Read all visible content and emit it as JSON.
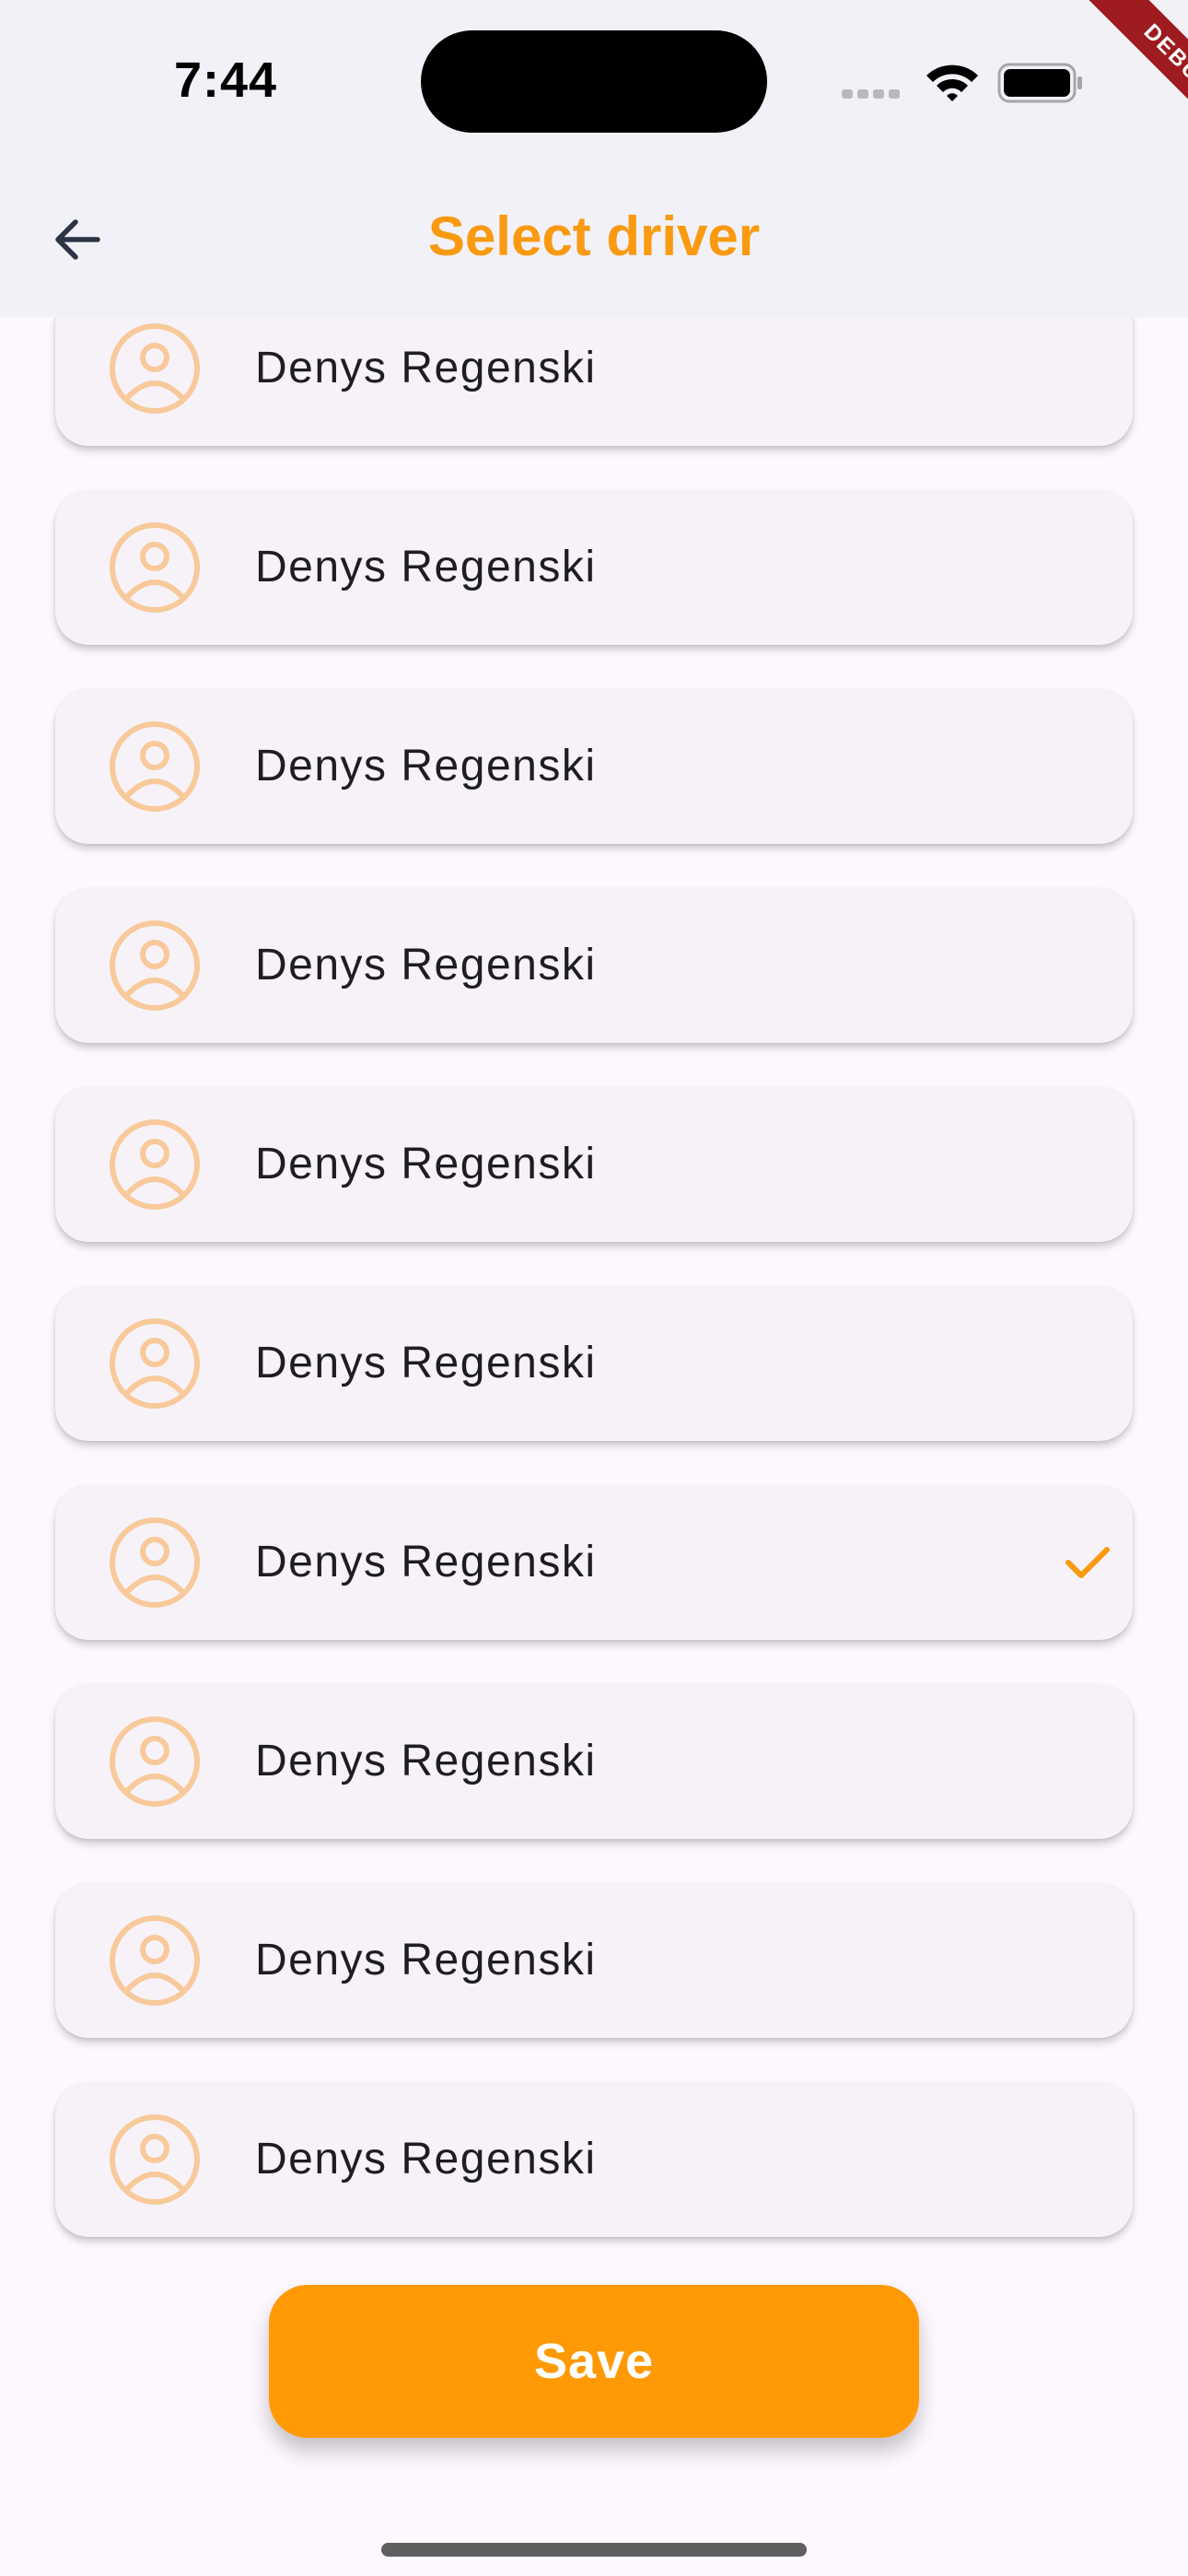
{
  "status_bar": {
    "time": "7:44",
    "debug_label": "DEBUG"
  },
  "app_bar": {
    "title": "Select driver",
    "back_icon": "arrow-back-icon"
  },
  "drivers": [
    {
      "name": "Denys Regenski",
      "selected": false
    },
    {
      "name": "Denys Regenski",
      "selected": false
    },
    {
      "name": "Denys Regenski",
      "selected": false
    },
    {
      "name": "Denys Regenski",
      "selected": false
    },
    {
      "name": "Denys Regenski",
      "selected": false
    },
    {
      "name": "Denys Regenski",
      "selected": false
    },
    {
      "name": "Denys Regenski",
      "selected": true
    },
    {
      "name": "Denys Regenski",
      "selected": false
    },
    {
      "name": "Denys Regenski",
      "selected": false
    },
    {
      "name": "Denys Regenski",
      "selected": false
    }
  ],
  "save_label": "Save",
  "colors": {
    "accent": "#FA9A11",
    "avatar": "#F8C99A",
    "button": "#FF9A05"
  }
}
